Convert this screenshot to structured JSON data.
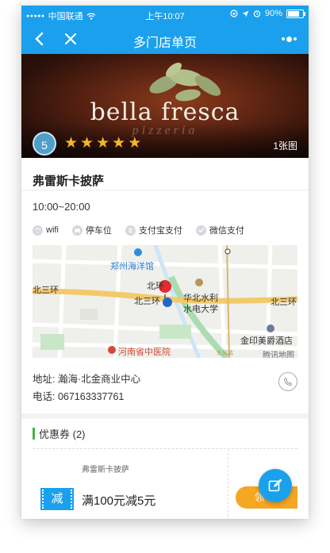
{
  "status_bar": {
    "carrier": "中国联通",
    "time": "上午10:07",
    "battery": "90%",
    "battery_level": 0.9
  },
  "nav": {
    "title": "多门店单页",
    "back_icon": "chevron-left-icon",
    "close_icon": "close-icon",
    "more_icon": "more-dots-icon"
  },
  "banner": {
    "brand_main": "bella fresca",
    "brand_sub": "pizzeria",
    "score": "5",
    "stars": 5,
    "photo_count": "1张图"
  },
  "store": {
    "name": "弗雷斯卡披萨",
    "hours": "10:00~20:00",
    "amenities": [
      {
        "icon": "wifi-icon",
        "label": "wifi"
      },
      {
        "icon": "parking-icon",
        "label": "停车位"
      },
      {
        "icon": "alipay-icon",
        "label": "支付宝支付"
      },
      {
        "icon": "wechat-pay-icon",
        "label": "微信支付"
      }
    ],
    "address": "地址: 瀚海·北金商业中心",
    "phone": "电话: 067163337761"
  },
  "map": {
    "labels": {
      "zhengzhou_ocean": "郑州海洋馆",
      "north_ring": "北三环",
      "north_ring_2": "北三环",
      "north_ring_3": "北三环",
      "bei": "北环",
      "ncwu_1": "华北水利",
      "ncwu_2": "水电大学",
      "jinyin_hotel": "金印美爵酒店",
      "henan_hospital": "河南省中医院",
      "road_label": "东风路",
      "map_brand": "腾讯地图"
    }
  },
  "coupons": {
    "title": "优惠券 (2)",
    "items": [
      {
        "store": "弗雷斯卡披萨",
        "tag": "减",
        "desc": "满100元减5元",
        "claim": "领"
      }
    ]
  },
  "colors": {
    "primary": "#1aa0ec",
    "star": "#f6b628",
    "green_accent": "#43b14b",
    "claim_orange": "#f5a623"
  }
}
